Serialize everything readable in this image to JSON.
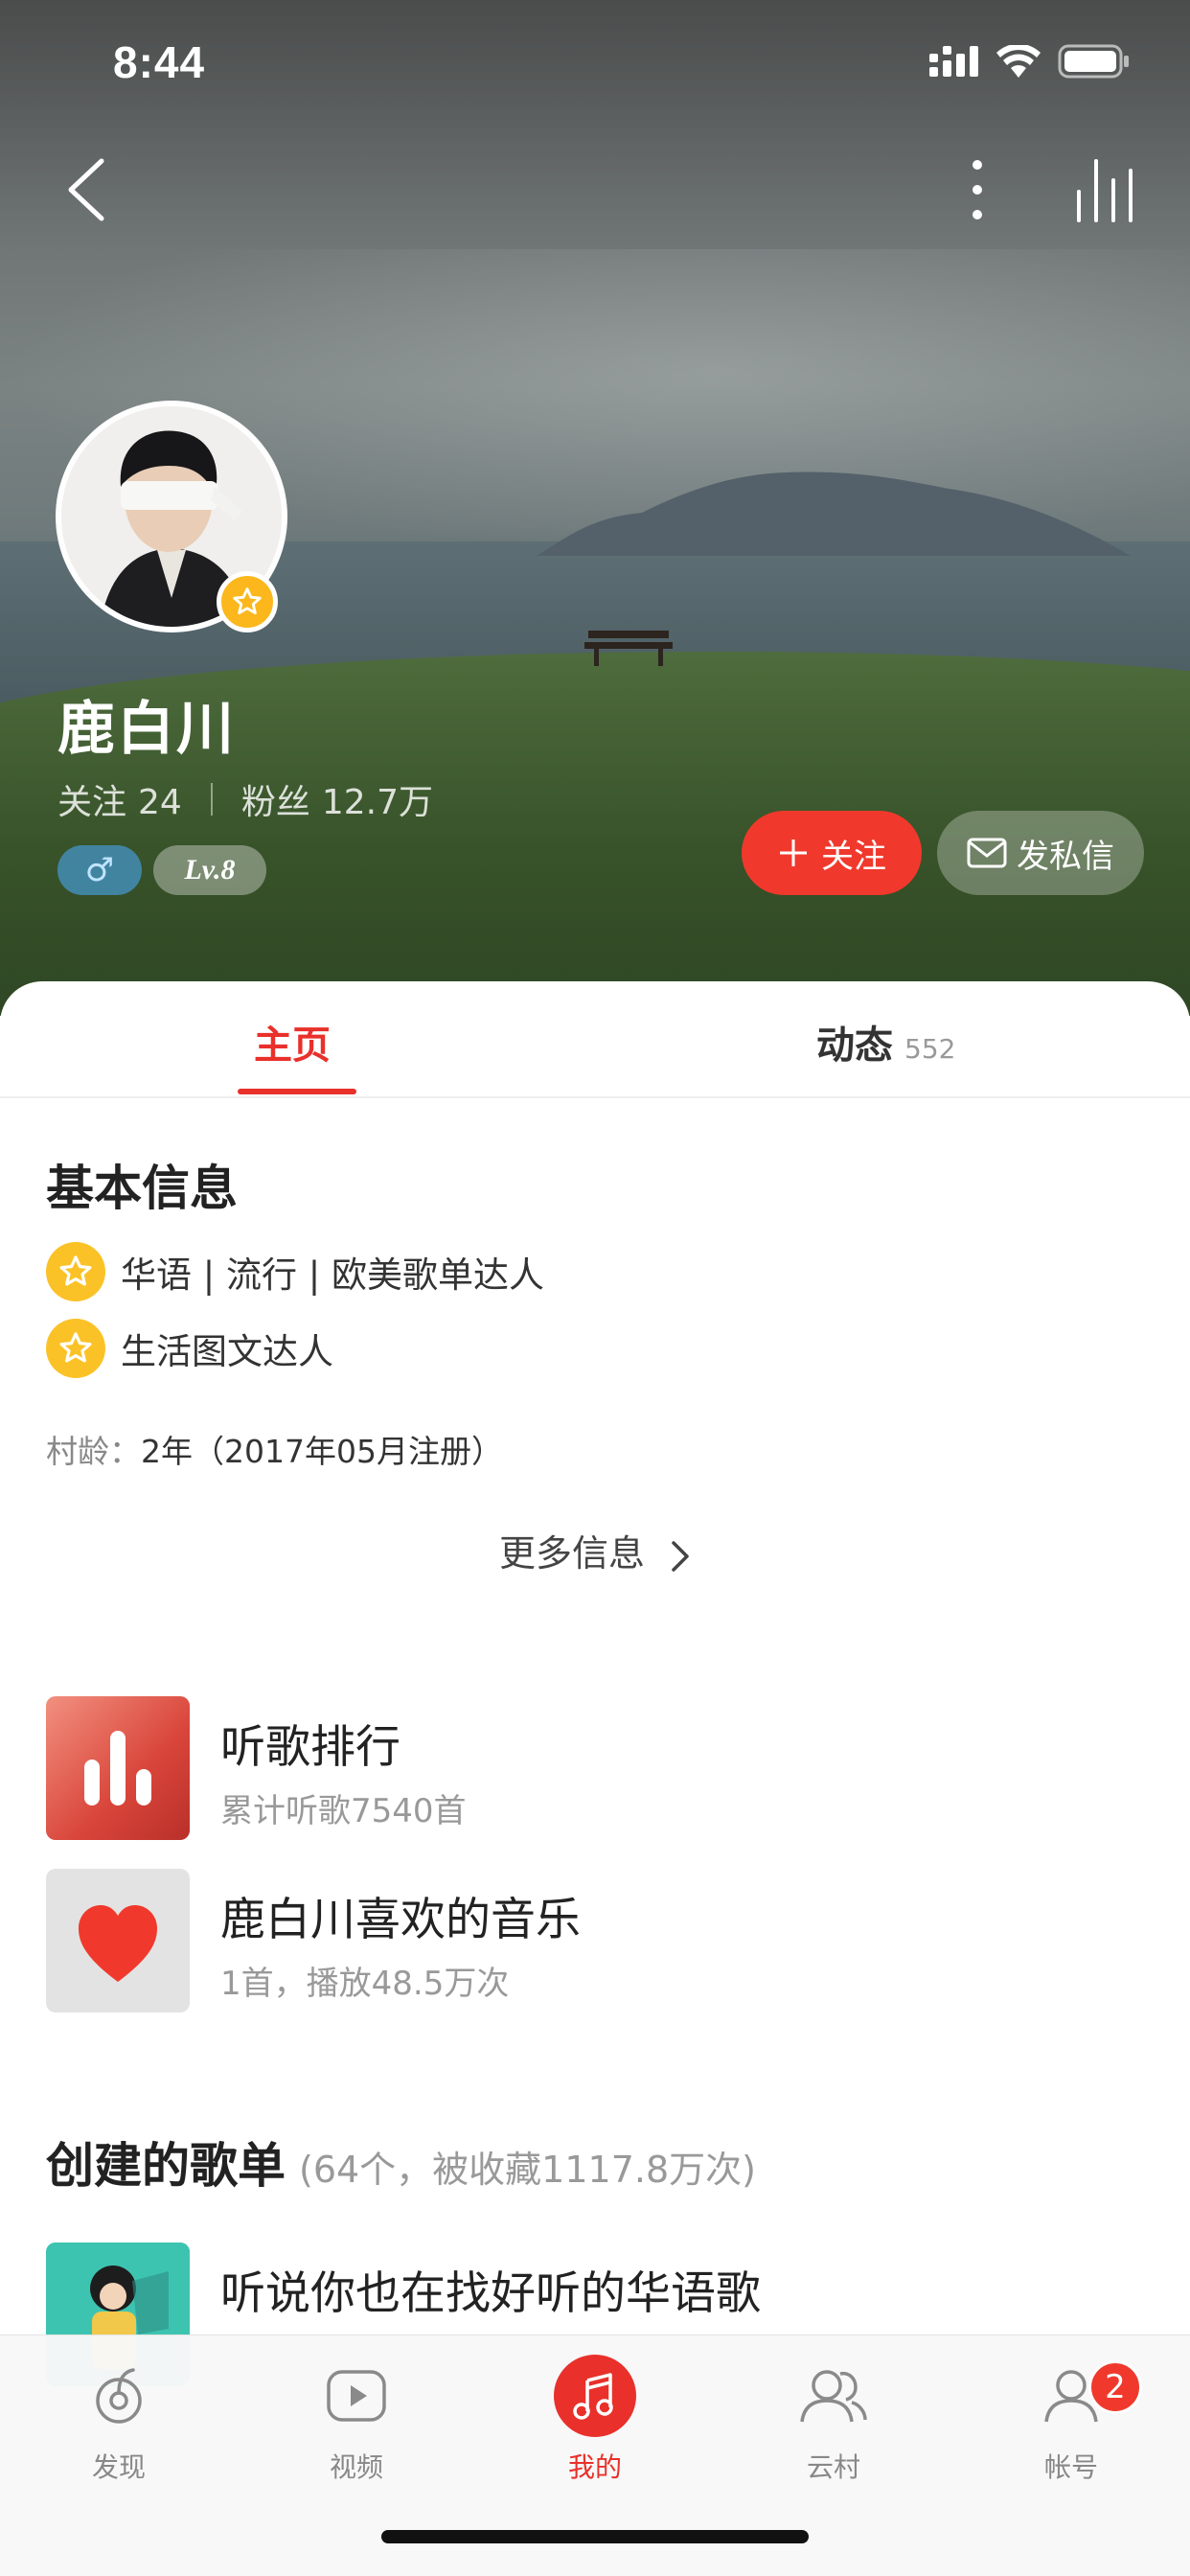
{
  "status_bar": {
    "time": "8:44"
  },
  "profile": {
    "name": "鹿白川",
    "following_label": "关注",
    "following_count": "24",
    "fans_label": "粉丝",
    "fans_count": "12.7万",
    "gender_symbol": "♂",
    "level": "Lv.8",
    "follow_button": "关注",
    "message_button": "发私信"
  },
  "tabs": {
    "home": "主页",
    "feed": "动态",
    "feed_count": "552"
  },
  "basic_info": {
    "title": "基本信息",
    "badges": [
      "华语 | 流行 | 欧美歌单达人",
      "生活图文达人"
    ],
    "village_age_label": "村龄：",
    "village_age_value": "2年（2017年05月注册）",
    "more_label": "更多信息"
  },
  "music_list": [
    {
      "title": "听歌排行",
      "subtitle": "累计听歌7540首"
    },
    {
      "title": "鹿白川喜欢的音乐",
      "subtitle": "1首，播放48.5万次"
    }
  ],
  "created_playlists": {
    "title": "创建的歌单",
    "meta": "(64个，被收藏1117.8万次)",
    "items": [
      {
        "title": "听说你也在找好听的华语歌"
      }
    ]
  },
  "tabbar": {
    "items": [
      {
        "label": "发现",
        "icon": "discover-icon"
      },
      {
        "label": "视频",
        "icon": "video-icon"
      },
      {
        "label": "我的",
        "icon": "music-note-icon"
      },
      {
        "label": "云村",
        "icon": "friends-icon"
      },
      {
        "label": "帐号",
        "icon": "account-icon"
      }
    ],
    "account_badge": "2",
    "active_index": 2
  },
  "colors": {
    "accent": "#e9302b",
    "star": "#fbc227"
  }
}
